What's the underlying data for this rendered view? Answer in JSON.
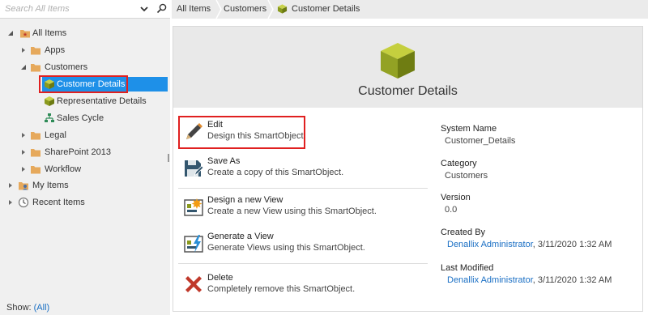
{
  "search": {
    "placeholder": "Search All Items"
  },
  "tree": {
    "root": "All Items",
    "apps": "Apps",
    "customers": "Customers",
    "customer_details": "Customer Details",
    "representative_details": "Representative Details",
    "sales_cycle": "Sales Cycle",
    "legal": "Legal",
    "sharepoint": "SharePoint 2013",
    "workflow": "Workflow",
    "my_items": "My Items",
    "recent_items": "Recent Items"
  },
  "footer": {
    "show_label": "Show:",
    "show_value": "(All)"
  },
  "breadcrumb": [
    "All Items",
    "Customers",
    "Customer Details"
  ],
  "hero": {
    "title": "Customer Details"
  },
  "actions": [
    {
      "title": "Edit",
      "desc": "Design this SmartObject.",
      "icon": "pencil-icon"
    },
    {
      "title": "Save As",
      "desc": "Create a copy of this SmartObject.",
      "icon": "save-as-icon"
    },
    {
      "title": "Design a new View",
      "desc": "Create a new View using this SmartObject.",
      "icon": "design-view-icon"
    },
    {
      "title": "Generate a View",
      "desc": "Generate Views using this SmartObject.",
      "icon": "generate-view-icon"
    },
    {
      "title": "Delete",
      "desc": "Completely remove this SmartObject.",
      "icon": "delete-x-icon"
    }
  ],
  "properties": {
    "system_name": {
      "label": "System Name",
      "value": "Customer_Details"
    },
    "category": {
      "label": "Category",
      "value": "Customers"
    },
    "version": {
      "label": "Version",
      "value": "0.0"
    },
    "created_by": {
      "label": "Created By",
      "user": "Denallix Administrator",
      "date": ", 3/11/2020 1:32 AM"
    },
    "last_modified": {
      "label": "Last Modified",
      "user": "Denallix Administrator",
      "date": ", 3/11/2020 1:32 AM"
    }
  },
  "colors": {
    "selection": "#1e90e8",
    "highlight": "#e02020",
    "link": "#1a6fc4",
    "smartobject": "#8a9a1e",
    "folder": "#e6a95c"
  }
}
